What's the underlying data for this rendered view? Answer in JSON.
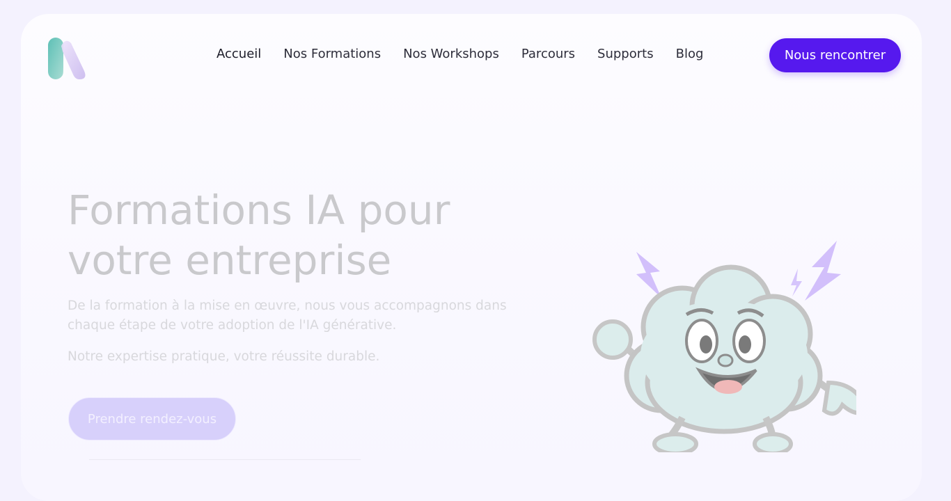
{
  "nav": {
    "items": [
      {
        "label": "Accueil"
      },
      {
        "label": "Nos Formations"
      },
      {
        "label": "Nos Workshops"
      },
      {
        "label": "Parcours"
      },
      {
        "label": "Supports"
      },
      {
        "label": "Blog"
      }
    ],
    "cta_label": "Nous rencontrer"
  },
  "hero": {
    "title_line1": "Formations IA pour",
    "title_line2": "votre entreprise",
    "subtitle": "De la formation à la mise en œuvre, nous vous accompagnons dans chaque étape de votre adoption de l'IA générative.",
    "tagline": "Notre expertise pratique, votre réussite durable.",
    "cta_label": "Prendre rendez-vous"
  },
  "colors": {
    "brand_purple": "#5619ee",
    "cta_light": "#d7d0fb",
    "logo_teal": "#6cc5bb",
    "logo_lilac": "#d6c8f3",
    "lightning": "#c9b5fb"
  },
  "icons": {
    "logo": "ia-logo",
    "mascot": "cloud-mascot-illustration"
  }
}
